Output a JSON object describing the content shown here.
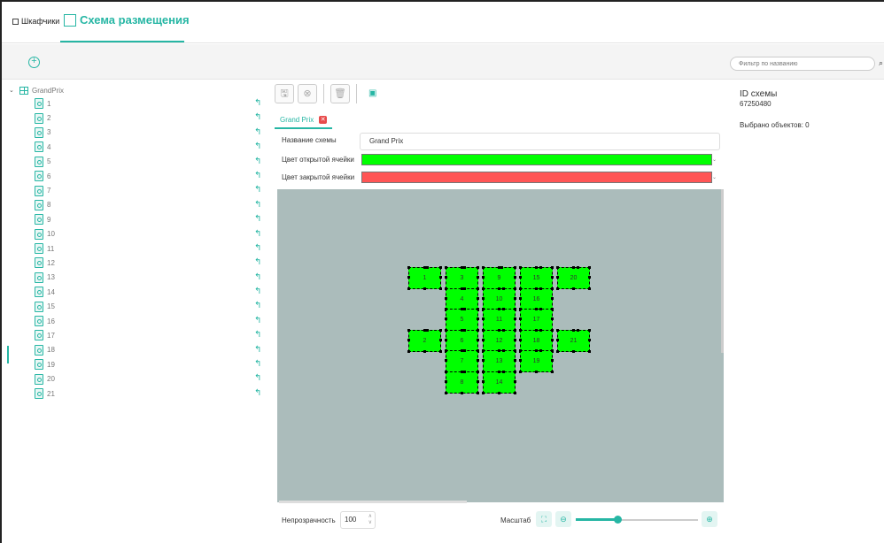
{
  "tabs": {
    "cabinets": "Шкафчики",
    "scheme": "Схема размещения"
  },
  "filter": {
    "placeholder": "Фильтр по названию"
  },
  "tree": {
    "root": "GrandPrix",
    "items": [
      "1",
      "2",
      "3",
      "4",
      "5",
      "6",
      "7",
      "8",
      "9",
      "10",
      "11",
      "12",
      "13",
      "14",
      "15",
      "16",
      "17",
      "18",
      "19",
      "20",
      "21"
    ]
  },
  "editor": {
    "tab_name": "Grand Prix",
    "name_label": "Название схемы",
    "name_value": "Grand Prix",
    "open_color_label": "Цвет открытой ячейки",
    "closed_color_label": "Цвет закрытой ячейки",
    "open_color": "#00ff00",
    "closed_color": "#ff5555",
    "canvas_background": "#abbcbb"
  },
  "cells": [
    {
      "label": "1",
      "col": 0,
      "row": 0
    },
    {
      "label": "3",
      "col": 1,
      "row": 0
    },
    {
      "label": "9",
      "col": 2,
      "row": 0
    },
    {
      "label": "15",
      "col": 3,
      "row": 0
    },
    {
      "label": "20",
      "col": 4,
      "row": 0
    },
    {
      "label": "4",
      "col": 1,
      "row": 1
    },
    {
      "label": "10",
      "col": 2,
      "row": 1
    },
    {
      "label": "16",
      "col": 3,
      "row": 1
    },
    {
      "label": "5",
      "col": 1,
      "row": 2
    },
    {
      "label": "11",
      "col": 2,
      "row": 2
    },
    {
      "label": "17",
      "col": 3,
      "row": 2
    },
    {
      "label": "2",
      "col": 0,
      "row": 3
    },
    {
      "label": "6",
      "col": 1,
      "row": 3
    },
    {
      "label": "12",
      "col": 2,
      "row": 3
    },
    {
      "label": "18",
      "col": 3,
      "row": 3
    },
    {
      "label": "21",
      "col": 4,
      "row": 3
    },
    {
      "label": "7",
      "col": 1,
      "row": 4
    },
    {
      "label": "13",
      "col": 2,
      "row": 4
    },
    {
      "label": "19",
      "col": 3,
      "row": 4
    },
    {
      "label": "8",
      "col": 1,
      "row": 5
    },
    {
      "label": "14",
      "col": 2,
      "row": 5
    }
  ],
  "bottom": {
    "opacity_label": "Непрозрачность",
    "opacity_value": "100",
    "zoom_label": "Масштаб",
    "zoom_level": 0.34
  },
  "details": {
    "id_title": "ID схемы",
    "id_value": "67250480",
    "selected_label": "Выбрано объектов: 0"
  },
  "accent_color": "#26b6a4"
}
